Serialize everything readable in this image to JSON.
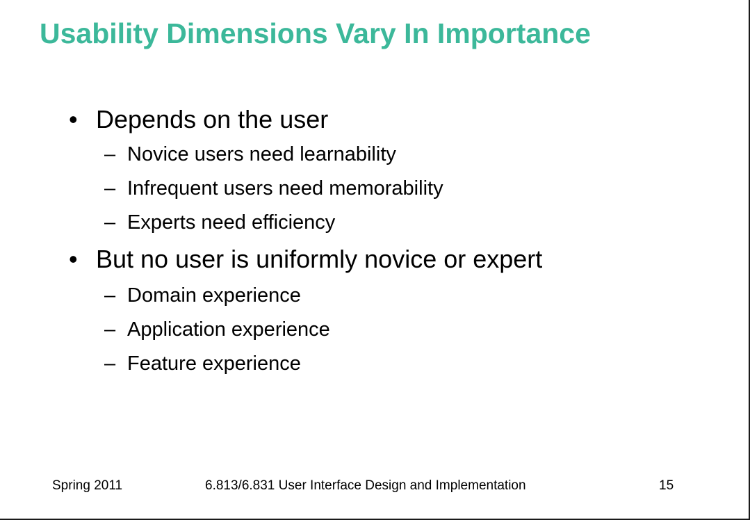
{
  "slide": {
    "title": "Usability Dimensions Vary In Importance",
    "bullets": [
      {
        "marker": "•",
        "text": "Depends on the user",
        "subitems": [
          {
            "marker": "–",
            "text": "Novice users need learnability"
          },
          {
            "marker": "–",
            "text": "Infrequent users need memorability"
          },
          {
            "marker": "–",
            "text": "Experts need efficiency"
          }
        ]
      },
      {
        "marker": "•",
        "text": "But no user is uniformly novice or expert",
        "subitems": [
          {
            "marker": "–",
            "text": "Domain experience"
          },
          {
            "marker": "–",
            "text": "Application experience"
          },
          {
            "marker": "–",
            "text": "Feature experience"
          }
        ]
      }
    ],
    "footer": {
      "left": "Spring 2011",
      "center": "6.813/6.831 User Interface Design and Implementation",
      "page_number": "15"
    },
    "colors": {
      "title": "#3cb89a",
      "text": "#000000",
      "background": "#ffffff"
    }
  }
}
